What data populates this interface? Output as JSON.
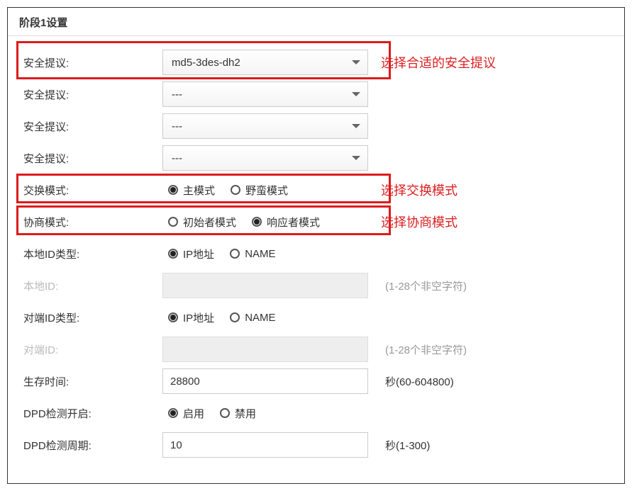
{
  "section_title": "阶段1设置",
  "rows": {
    "proposal1": {
      "label": "安全提议:",
      "value": "md5-3des-dh2",
      "annotation": "选择合适的安全提议"
    },
    "proposal2": {
      "label": "安全提议:",
      "value": "---"
    },
    "proposal3": {
      "label": "安全提议:",
      "value": "---"
    },
    "proposal4": {
      "label": "安全提议:",
      "value": "---"
    },
    "exchange_mode": {
      "label": "交换模式:",
      "opt1": "主模式",
      "opt2": "野蛮模式",
      "selected": 0,
      "annotation": "选择交换模式"
    },
    "nego_mode": {
      "label": "协商模式:",
      "opt1": "初始者模式",
      "opt2": "响应者模式",
      "selected": 1,
      "annotation": "选择协商模式"
    },
    "local_id_type": {
      "label": "本地ID类型:",
      "opt1": "IP地址",
      "opt2": "NAME",
      "selected": 0
    },
    "local_id": {
      "label": "本地ID:",
      "hint": "(1-28个非空字符)"
    },
    "remote_id_type": {
      "label": "对端ID类型:",
      "opt1": "IP地址",
      "opt2": "NAME",
      "selected": 0
    },
    "remote_id": {
      "label": "对端ID:",
      "hint": "(1-28个非空字符)"
    },
    "lifetime": {
      "label": "生存时间:",
      "value": "28800",
      "hint": "秒(60-604800)"
    },
    "dpd_enable": {
      "label": "DPD检测开启:",
      "opt1": "启用",
      "opt2": "禁用",
      "selected": 0
    },
    "dpd_interval": {
      "label": "DPD检测周期:",
      "value": "10",
      "hint": "秒(1-300)"
    }
  }
}
